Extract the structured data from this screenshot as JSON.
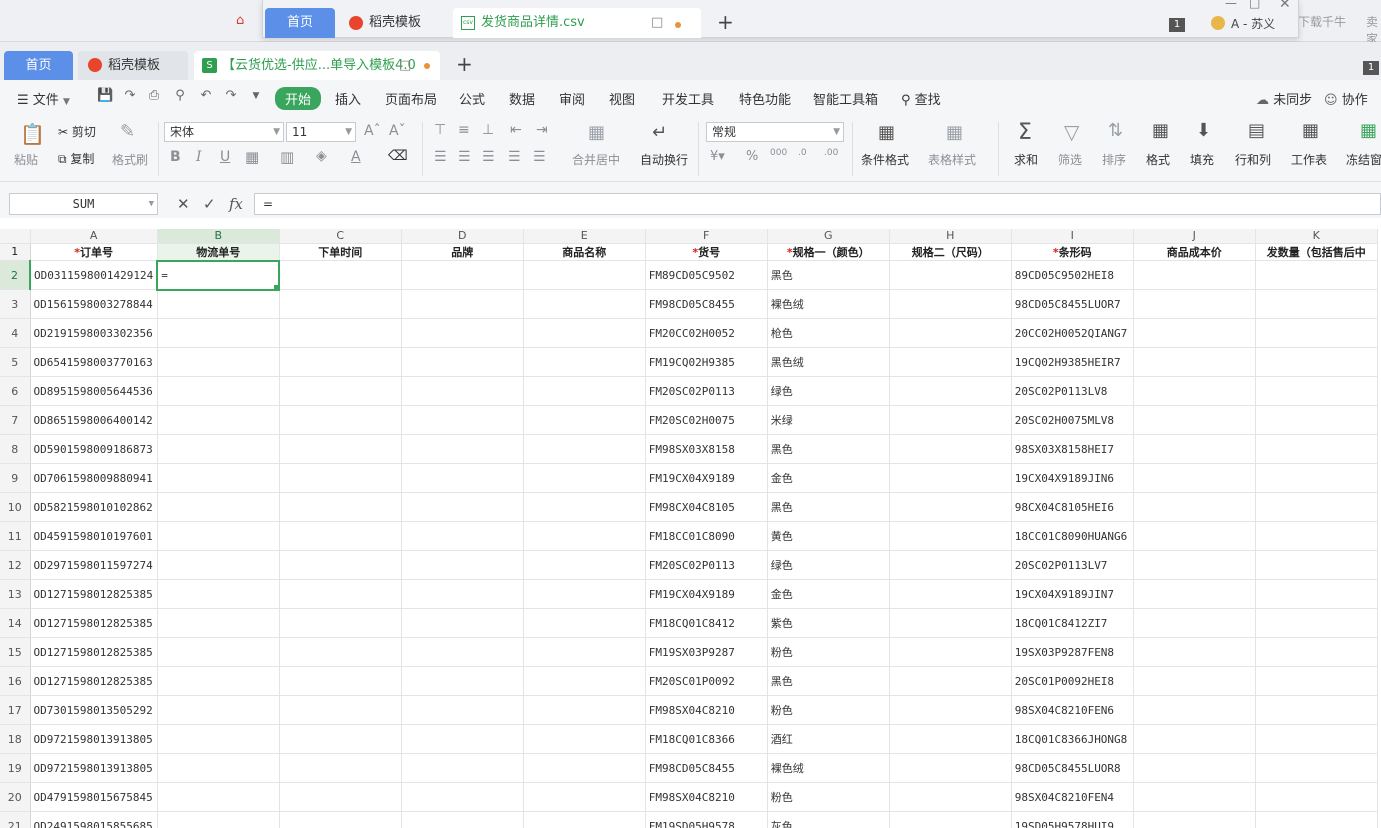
{
  "bg_window": {
    "right_texts": [
      "下载千牛",
      "卖家"
    ]
  },
  "float_window": {
    "tabs": [
      "首页",
      "稻壳模板",
      "发货商品详情.csv"
    ],
    "badge": "1",
    "user": "A - 苏义",
    "csv_icon_text": "csv"
  },
  "tabs": [
    {
      "label": "首页"
    },
    {
      "label": "稻壳模板"
    },
    {
      "label": "【云货优选-供应...单导入模板4.0",
      "icon": "S"
    }
  ],
  "tab_count_badge": "1",
  "menu": {
    "file": "文件",
    "items": [
      "开始",
      "插入",
      "页面布局",
      "公式",
      "数据",
      "审阅",
      "视图",
      "开发工具",
      "特色功能",
      "智能工具箱"
    ],
    "search": "查找",
    "sync": "未同步",
    "collab": "协作"
  },
  "ribbon": {
    "paste": "粘贴",
    "cut": "剪切",
    "copy": "复制",
    "format_painter": "格式刷",
    "font_name": "宋体",
    "font_size": "11",
    "merge_center": "合并居中",
    "wrap_text": "自动换行",
    "number_format": "常规",
    "conditional_format": "条件格式",
    "table_style": "表格样式",
    "sum": "求和",
    "filter": "筛选",
    "sort": "排序",
    "format": "格式",
    "fill": "填充",
    "row_col": "行和列",
    "worksheet": "工作表",
    "freeze": "冻结窗"
  },
  "formula_bar": {
    "name_box": "SUM",
    "formula": "="
  },
  "grid": {
    "col_letters": [
      "A",
      "B",
      "C",
      "D",
      "E",
      "F",
      "G",
      "H",
      "I",
      "J",
      "K"
    ],
    "selected_col": 1,
    "selected_row": 2,
    "headers": [
      {
        "text": "订单号",
        "required": true
      },
      {
        "text": "物流单号",
        "required": false
      },
      {
        "text": "下单时间",
        "required": false
      },
      {
        "text": "品牌",
        "required": false
      },
      {
        "text": "商品名称",
        "required": false
      },
      {
        "text": "货号",
        "required": true
      },
      {
        "text": "规格一（颜色）",
        "required": true
      },
      {
        "text": "规格二（尺码）",
        "required": false
      },
      {
        "text": "条形码",
        "required": true
      },
      {
        "text": "商品成本价",
        "required": false
      },
      {
        "text": "发数量（包括售后中",
        "required": false
      }
    ],
    "active_cell_value": "=",
    "rows": [
      {
        "n": "2",
        "a": "OD0311598001429124",
        "f": "FM89CD05C9502",
        "g": "黑色",
        "i": "89CD05C9502HEI8"
      },
      {
        "n": "3",
        "a": "OD1561598003278844",
        "f": "FM98CD05C8455",
        "g": "裸色绒",
        "i": "98CD05C8455LUOR7"
      },
      {
        "n": "4",
        "a": "OD2191598003302356",
        "f": "FM20CC02H0052",
        "g": "枪色",
        "i": "20CC02H0052QIANG7"
      },
      {
        "n": "5",
        "a": "OD6541598003770163",
        "f": "FM19CQ02H9385",
        "g": "黑色绒",
        "i": "19CQ02H9385HEIR7"
      },
      {
        "n": "6",
        "a": "OD8951598005644536",
        "f": "FM20SC02P0113",
        "g": "绿色",
        "i": "20SC02P0113LV8"
      },
      {
        "n": "7",
        "a": "OD8651598006400142",
        "f": "FM20SC02H0075",
        "g": "米绿",
        "i": "20SC02H0075MLV8"
      },
      {
        "n": "8",
        "a": "OD5901598009186873",
        "f": "FM98SX03X8158",
        "g": "黑色",
        "i": "98SX03X8158HEI7"
      },
      {
        "n": "9",
        "a": "OD7061598009880941",
        "f": "FM19CX04X9189",
        "g": "金色",
        "i": "19CX04X9189JIN6"
      },
      {
        "n": "10",
        "a": "OD5821598010102862",
        "f": "FM98CX04C8105",
        "g": "黑色",
        "i": "98CX04C8105HEI6"
      },
      {
        "n": "11",
        "a": "OD4591598010197601",
        "f": "FM18CC01C8090",
        "g": "黄色",
        "i": "18CC01C8090HUANG6"
      },
      {
        "n": "12",
        "a": "OD2971598011597274",
        "f": "FM20SC02P0113",
        "g": "绿色",
        "i": "20SC02P0113LV7"
      },
      {
        "n": "13",
        "a": "OD1271598012825385",
        "f": "FM19CX04X9189",
        "g": "金色",
        "i": "19CX04X9189JIN7"
      },
      {
        "n": "14",
        "a": "OD1271598012825385",
        "f": "FM18CQ01C8412",
        "g": "紫色",
        "i": "18CQ01C8412ZI7"
      },
      {
        "n": "15",
        "a": "OD1271598012825385",
        "f": "FM19SX03P9287",
        "g": "粉色",
        "i": "19SX03P9287FEN8"
      },
      {
        "n": "16",
        "a": "OD1271598012825385",
        "f": "FM20SC01P0092",
        "g": "黑色",
        "i": "20SC01P0092HEI8"
      },
      {
        "n": "17",
        "a": "OD7301598013505292",
        "f": "FM98SX04C8210",
        "g": "粉色",
        "i": "98SX04C8210FEN6"
      },
      {
        "n": "18",
        "a": "OD9721598013913805",
        "f": "FM18CQ01C8366",
        "g": "酒红",
        "i": "18CQ01C8366JHONG8"
      },
      {
        "n": "19",
        "a": "OD9721598013913805",
        "f": "FM98CD05C8455",
        "g": "裸色绒",
        "i": "98CD05C8455LUOR8"
      },
      {
        "n": "20",
        "a": "OD4791598015675845",
        "f": "FM98SX04C8210",
        "g": "粉色",
        "i": "98SX04C8210FEN4"
      },
      {
        "n": "21",
        "a": "OD2491598015855685",
        "f": "FM19SD05H9578",
        "g": "灰色",
        "i": "19SD05H9578HUI9"
      }
    ]
  }
}
